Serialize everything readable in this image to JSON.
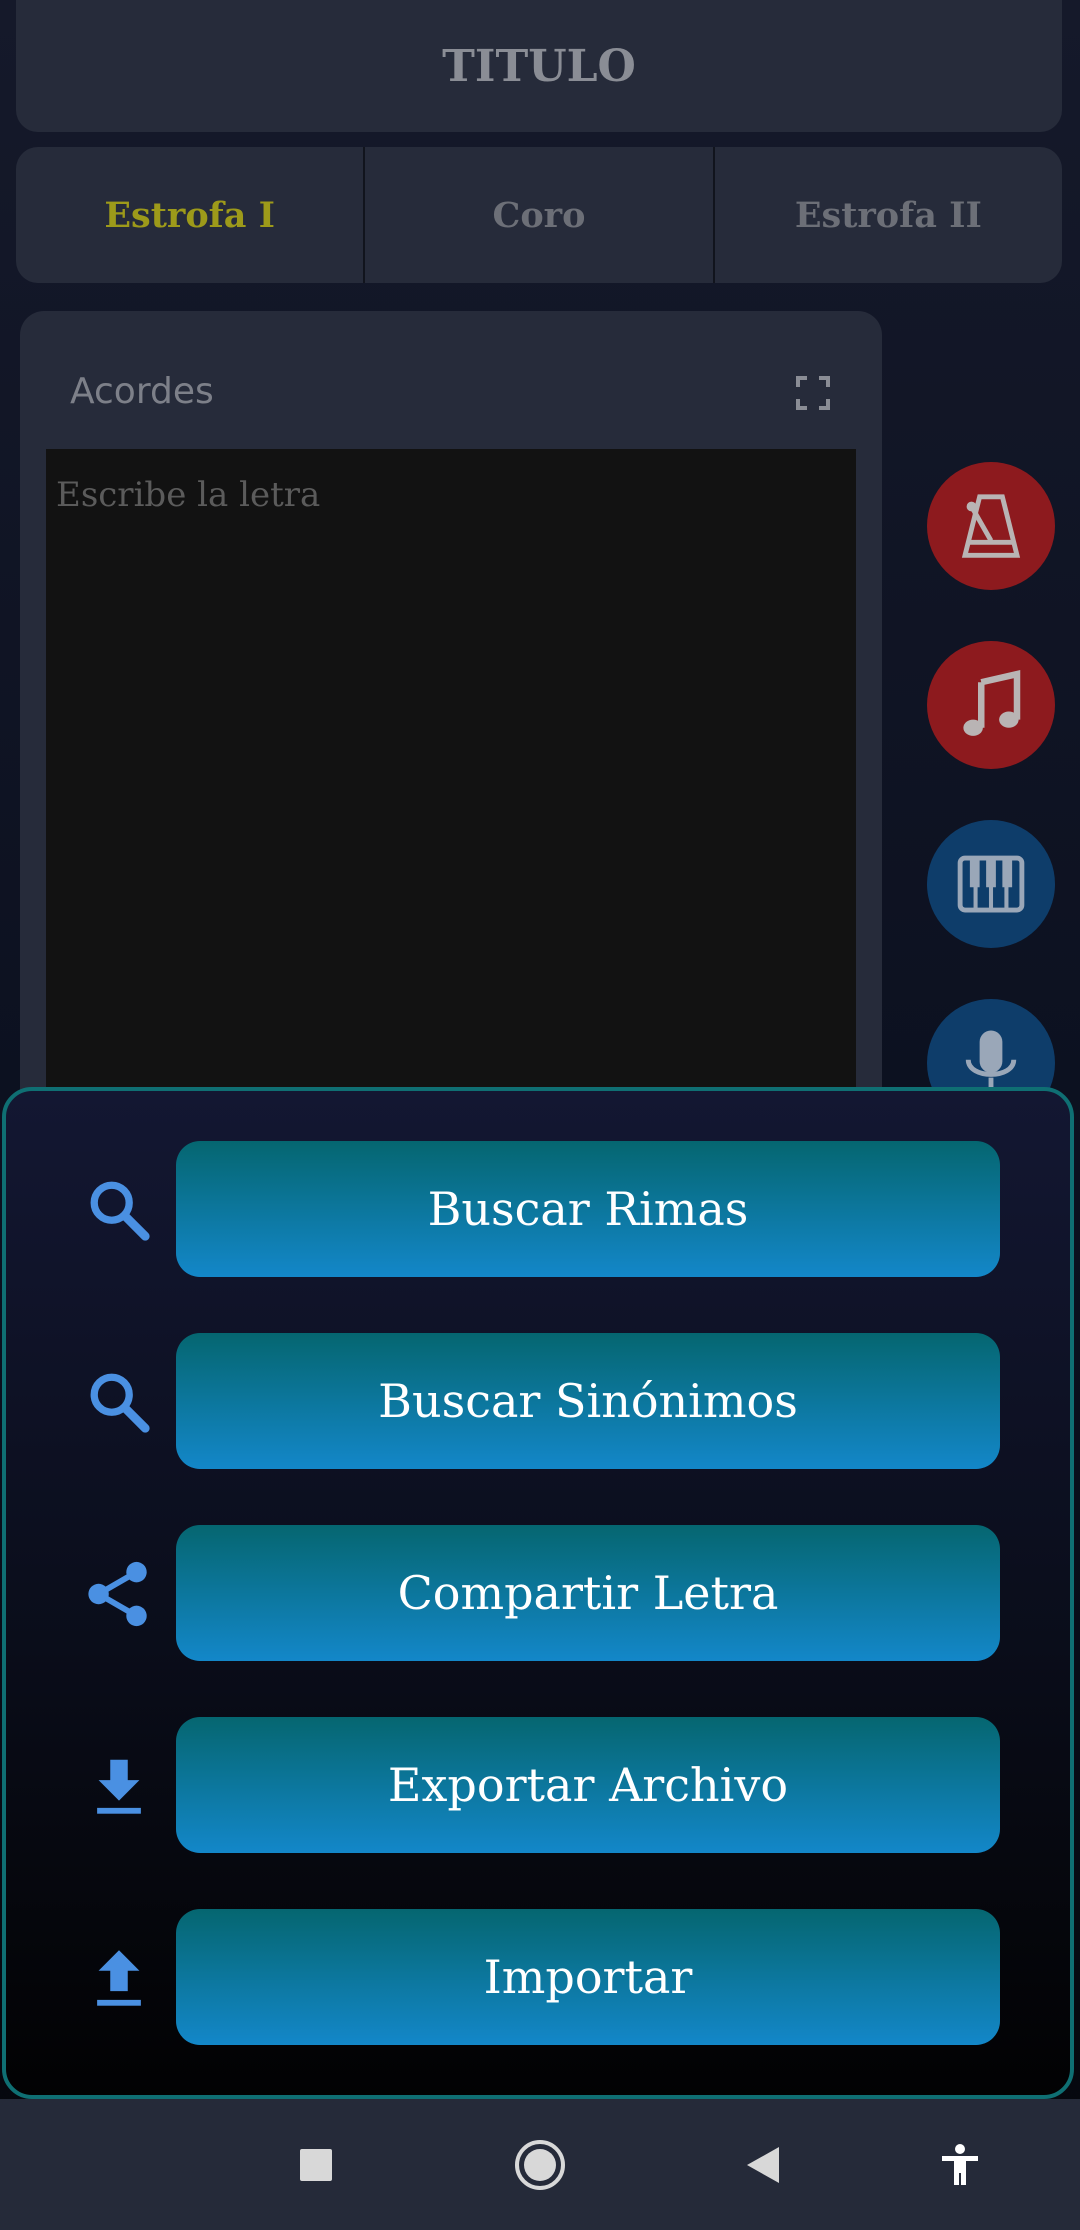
{
  "header": {
    "title": "TITULO"
  },
  "tabs": [
    {
      "label": "Estrofa I",
      "active": true
    },
    {
      "label": "Coro",
      "active": false
    },
    {
      "label": "Estrofa II",
      "active": false
    }
  ],
  "editor": {
    "chords_label": "Acordes",
    "lyrics_placeholder": "Escribe la letra"
  },
  "side_tools": [
    {
      "icon": "metronome-icon",
      "color": "#8d1a1e"
    },
    {
      "icon": "music-note-icon",
      "color": "#8d1a1e"
    },
    {
      "icon": "piano-icon",
      "color": "#0e3d6a"
    },
    {
      "icon": "microphone-icon",
      "color": "#0e3d6a"
    }
  ],
  "actions": [
    {
      "icon": "search-icon",
      "label": "Buscar Rimas"
    },
    {
      "icon": "search-icon",
      "label": "Buscar Sinónimos"
    },
    {
      "icon": "share-icon",
      "label": "Compartir Letra"
    },
    {
      "icon": "download-icon",
      "label": "Exportar Archivo"
    },
    {
      "icon": "upload-icon",
      "label": "Importar"
    }
  ],
  "colors": {
    "active_tab": "#9d9a1a",
    "button_gradient_top": "#056670",
    "button_gradient_bottom": "#1387c9",
    "sheet_border": "#0f6f73",
    "icon_blue": "#4a90e2"
  },
  "navbar": [
    "recents-icon",
    "home-icon",
    "back-icon",
    "accessibility-icon"
  ]
}
